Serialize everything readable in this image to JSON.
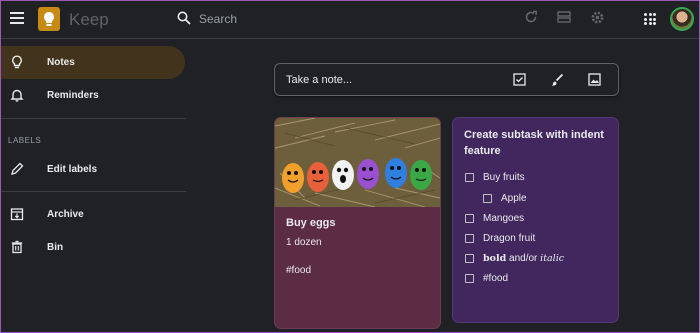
{
  "header": {
    "app_title": "Keep",
    "search_placeholder": "Search"
  },
  "sidebar": {
    "items": [
      {
        "label": "Notes",
        "icon": "lightbulb-icon",
        "active": true
      },
      {
        "label": "Reminders",
        "icon": "bell-icon"
      }
    ],
    "labels_heading": "LABELS",
    "edit_labels": "Edit labels",
    "archive": "Archive",
    "bin": "Bin"
  },
  "take_note": {
    "placeholder": "Take a note..."
  },
  "notes": [
    {
      "title": "Buy eggs",
      "body_line1": "1 dozen",
      "body_line2": "#food",
      "color": "#5c2b44",
      "image": "painted-eggs-on-straw"
    },
    {
      "title": "Create subtask with indent feature",
      "color": "#42275e",
      "items": [
        {
          "text": "Buy fruits"
        },
        {
          "text": "Apple",
          "indent": true
        },
        {
          "text": "Mangoes"
        },
        {
          "text": "Dragon fruit"
        },
        {
          "bold": "bold",
          "middle": " and/or ",
          "italic": "italic"
        },
        {
          "text": "#food"
        }
      ]
    }
  ],
  "colors": {
    "background": "#202124",
    "accent_active": "#41331c",
    "keep_yellow": "#c78a13"
  }
}
